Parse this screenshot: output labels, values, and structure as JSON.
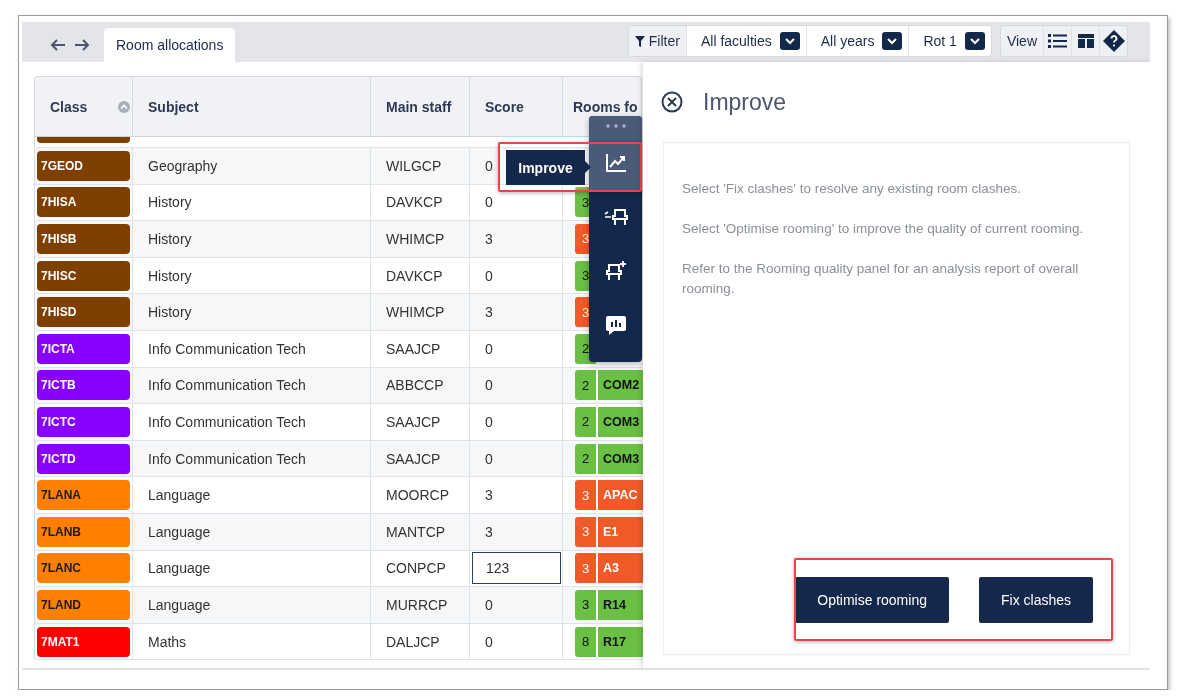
{
  "tab_bar": {
    "tabs": [
      {
        "label": "Room allocations",
        "selected": true
      }
    ]
  },
  "toolbar": {
    "filter": "Filter",
    "dropdowns": [
      "All faculties",
      "All years",
      "Rot 1"
    ],
    "view": "View"
  },
  "table": {
    "columns": [
      "Class",
      "Subject",
      "Main staff",
      "Score",
      "Rooms fo"
    ],
    "rows": [
      {
        "class": "7GEOD",
        "color": "#7f3f00",
        "subject": "Geography",
        "staff": "WILGCP",
        "score": "0",
        "focused": false
      },
      {
        "class": "7HISA",
        "color": "#7f3f00",
        "subject": "History",
        "staff": "DAVKCP",
        "score": "0",
        "focused": false,
        "rooms": {
          "count": "3",
          "color": "#6abf45"
        }
      },
      {
        "class": "7HISB",
        "color": "#7f3f00",
        "subject": "History",
        "staff": "WHIMCP",
        "score": "3",
        "focused": false,
        "rooms": {
          "count": "3",
          "color": "#f05a28"
        }
      },
      {
        "class": "7HISC",
        "color": "#7f3f00",
        "subject": "History",
        "staff": "DAVKCP",
        "score": "0",
        "focused": false,
        "rooms": {
          "count": "3",
          "color": "#6abf45"
        }
      },
      {
        "class": "7HISD",
        "color": "#7f3f00",
        "subject": "History",
        "staff": "WHIMCP",
        "score": "3",
        "focused": false,
        "rooms": {
          "count": "3",
          "color": "#f05a28"
        }
      },
      {
        "class": "7ICTA",
        "color": "#8800ff",
        "subject": "Info Communication Tech",
        "staff": "SAAJCP",
        "score": "0",
        "focused": false,
        "rooms": {
          "count": "2",
          "color": "#6abf45"
        }
      },
      {
        "class": "7ICTB",
        "color": "#8800ff",
        "subject": "Info Communication Tech",
        "staff": "ABBCCP",
        "score": "0",
        "focused": false,
        "rooms": {
          "count": "2",
          "color": "#6abf45",
          "room": "COM2"
        }
      },
      {
        "class": "7ICTC",
        "color": "#8800ff",
        "subject": "Info Communication Tech",
        "staff": "SAAJCP",
        "score": "0",
        "focused": false,
        "rooms": {
          "count": "2",
          "color": "#6abf45",
          "room": "COM3"
        }
      },
      {
        "class": "7ICTD",
        "color": "#8800ff",
        "subject": "Info Communication Tech",
        "staff": "SAAJCP",
        "score": "0",
        "focused": false,
        "rooms": {
          "count": "2",
          "color": "#6abf45",
          "room": "COM3"
        }
      },
      {
        "class": "7LANA",
        "color": "#ff8000",
        "subject": "Language",
        "staff": "MOORCP",
        "score": "3",
        "focused": false,
        "rooms": {
          "count": "3",
          "color": "#f05a28",
          "room": "APAC"
        }
      },
      {
        "class": "7LANB",
        "color": "#ff8000",
        "subject": "Language",
        "staff": "MANTCP",
        "score": "3",
        "focused": false,
        "rooms": {
          "count": "3",
          "color": "#f05a28",
          "room": "E1"
        }
      },
      {
        "class": "7LANC",
        "color": "#ff8000",
        "subject": "Language",
        "staff": "CONPCP",
        "score": "123",
        "focused": true,
        "rooms": {
          "count": "3",
          "color": "#f05a28",
          "room": "A3"
        }
      },
      {
        "class": "7LAND",
        "color": "#ff8000",
        "subject": "Language",
        "staff": "MURRCP",
        "score": "0",
        "focused": false,
        "rooms": {
          "count": "3",
          "color": "#6abf45",
          "room": "R14"
        }
      },
      {
        "class": "7MAT1",
        "color": "#ff0000",
        "subject": "Maths",
        "staff": "DALJCP",
        "score": "0",
        "focused": false,
        "rooms": {
          "count": "8",
          "color": "#6abf45",
          "room": "R17"
        }
      }
    ]
  },
  "float_toolbar": {
    "tools": [
      {
        "kind": "chart",
        "selected": true,
        "tooltip": "Improve"
      },
      {
        "kind": "swap",
        "selected": false
      },
      {
        "kind": "add",
        "selected": false
      },
      {
        "kind": "report",
        "selected": false
      }
    ]
  },
  "panel": {
    "title": "Improve",
    "paragraphs": [
      "Select 'Fix clashes' to resolve any existing room clashes.",
      "Select 'Optimise rooming' to improve the quality of current rooming.",
      "Refer to the Rooming quality panel for an analysis report of overall rooming."
    ],
    "buttons": [
      "Optimise rooming",
      "Fix clashes"
    ]
  }
}
